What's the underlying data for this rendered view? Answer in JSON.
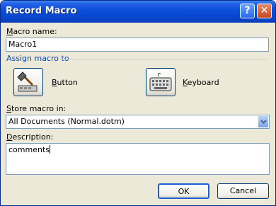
{
  "window": {
    "title": "Record Macro"
  },
  "titlebar": {
    "help_label": "?",
    "close_label": "✕"
  },
  "macro_name": {
    "label_prefix": "",
    "label_key": "M",
    "label_rest": "acro name:",
    "value": "Macro1"
  },
  "assign": {
    "label": "Assign macro to"
  },
  "button_option": {
    "label_key": "B",
    "label_rest": "utton",
    "icon": "hammer-icon"
  },
  "keyboard_option": {
    "label_key": "K",
    "label_rest": "eyboard",
    "icon": "keyboard-icon"
  },
  "store": {
    "label_key": "S",
    "label_rest": "tore macro in:",
    "value": "All Documents (Normal.dotm)"
  },
  "description": {
    "label_key": "D",
    "label_rest": "escription:",
    "value": "comments"
  },
  "actions": {
    "ok": "OK",
    "cancel": "Cancel"
  },
  "colors": {
    "group_label": "#0046d5",
    "titlebar": "#0845cc",
    "field_border": "#7f9db9"
  }
}
